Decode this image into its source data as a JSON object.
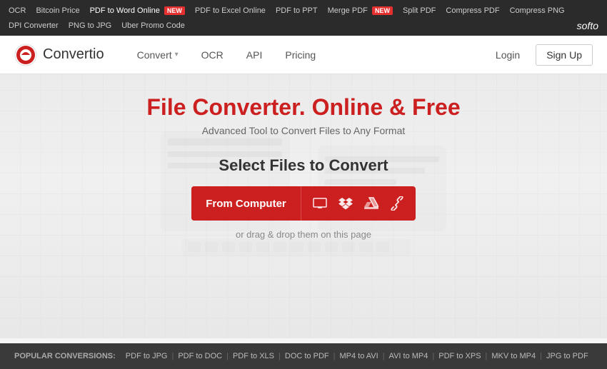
{
  "topbar": {
    "links": [
      {
        "label": "OCR",
        "active": false,
        "new": false
      },
      {
        "label": "Bitcoin Price",
        "active": false,
        "new": false
      },
      {
        "label": "PDF to Word Online",
        "active": true,
        "new": true
      },
      {
        "label": "PDF to Excel Online",
        "active": false,
        "new": false
      },
      {
        "label": "PDF to PPT",
        "active": false,
        "new": false
      },
      {
        "label": "Merge PDF",
        "active": false,
        "new": true
      },
      {
        "label": "Split PDF",
        "active": false,
        "new": false
      },
      {
        "label": "Compress PDF",
        "active": false,
        "new": false
      },
      {
        "label": "Compress PNG",
        "active": false,
        "new": false
      },
      {
        "label": "DPI Converter",
        "active": false,
        "new": false
      },
      {
        "label": "PNG to JPG",
        "active": false,
        "new": false
      },
      {
        "label": "Uber Promo Code",
        "active": false,
        "new": false
      }
    ],
    "brand": "softo"
  },
  "nav": {
    "logo_text": "Convertio",
    "links": [
      {
        "label": "Convert",
        "has_dropdown": true
      },
      {
        "label": "OCR",
        "has_dropdown": false
      },
      {
        "label": "API",
        "has_dropdown": false
      },
      {
        "label": "Pricing",
        "has_dropdown": false
      }
    ],
    "login_label": "Login",
    "signup_label": "Sign Up"
  },
  "hero": {
    "title": "File Converter. Online & Free",
    "subtitle": "Advanced Tool to Convert Files to Any Format",
    "select_files_title": "Select Files to Convert",
    "from_computer_label": "From Computer",
    "drag_drop_text": "or drag & drop them on this page"
  },
  "footer": {
    "popular_label": "POPULAR CONVERSIONS:",
    "links": [
      "PDF to JPG",
      "PDF to DOC",
      "PDF to XLS",
      "DOC to PDF",
      "MP4 to AVI",
      "AVI to MP4",
      "PDF to XPS",
      "MKV to MP4",
      "JPG to PDF"
    ]
  }
}
